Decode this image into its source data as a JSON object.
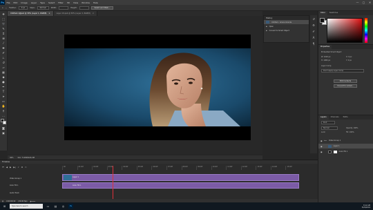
{
  "menubar": {
    "logo": "Ps",
    "items": [
      "File",
      "Edit",
      "Image",
      "Layer",
      "Type",
      "Select",
      "Filter",
      "3D",
      "View",
      "Window",
      "Help"
    ],
    "window_controls": [
      "—",
      "▢",
      "✕"
    ]
  },
  "options": {
    "feather_label": "Feather:",
    "feather_value": "0 px",
    "style_label": "Style:",
    "style_value": "Normal",
    "width_label": "Width:",
    "height_label": "Height:",
    "select_mask": "Select and Mask..."
  },
  "doc_tabs": [
    {
      "label": "Untitled-1@psd @ 30% (Layer 1, RGB/8)",
      "close": "×"
    },
    {
      "label": "Layer 19.psb @ 50% (Layer 2, RGB/8)",
      "close": "×"
    }
  ],
  "status": {
    "zoom": "30%",
    "doc_size": "Doc: 5.93M/120.2M"
  },
  "history": {
    "title": "History",
    "rows": [
      "Untitled - Ariana Grande",
      "Open",
      "Convert to Smart Object"
    ]
  },
  "color_panel": {
    "tabs": [
      "Color",
      "Swatches"
    ],
    "hue_colors": [
      "#ff0000",
      "#ffff00",
      "#00ff00",
      "#00ffff",
      "#0000ff",
      "#ff00ff"
    ]
  },
  "properties": {
    "tabs": [
      "Properties"
    ],
    "type": "Embedded Smart Object",
    "w": "W: 1920 px",
    "h": "H: 1080 px",
    "x": "X: 0 px",
    "y": "Y: 0 px",
    "layer_comp": "Layer Comp",
    "layer_comp_value": "Don't Apply Layer Comp",
    "edit_contents": "Edit Contents",
    "convert": "Convert to Linked..."
  },
  "layers": {
    "tabs": [
      "Layers",
      "Channels",
      "Paths"
    ],
    "kind": "Kind",
    "blend": "Normal",
    "opacity": "Opacity: 100%",
    "lock": "Lock:",
    "fill": "Fill: 100%",
    "rows": [
      "Video Group 1",
      "Layer 1",
      "Color Fill 1"
    ]
  },
  "timeline": {
    "title": "Timeline",
    "ticks": [
      "00",
      "01:00f",
      "02:00f",
      "03:00f",
      "04:00f",
      "05:00f",
      "06:00f",
      "07:00f",
      "08:00f",
      "09:00f",
      "10:00f",
      "11:00f",
      "12:00f",
      "13:00f",
      "14:00f",
      "15:00f"
    ],
    "tracks": [
      "Video Group 1",
      "Color Fill 1",
      "Audio Track"
    ],
    "clips": [
      "Layer 1",
      "Color Fill 1"
    ],
    "timecode": "0:00:00:10",
    "fps": "(30.00 fps)"
  },
  "taskbar": {
    "search_placeholder": "Type here to search",
    "time": "8:12 AM",
    "date": "5/29/2019"
  }
}
